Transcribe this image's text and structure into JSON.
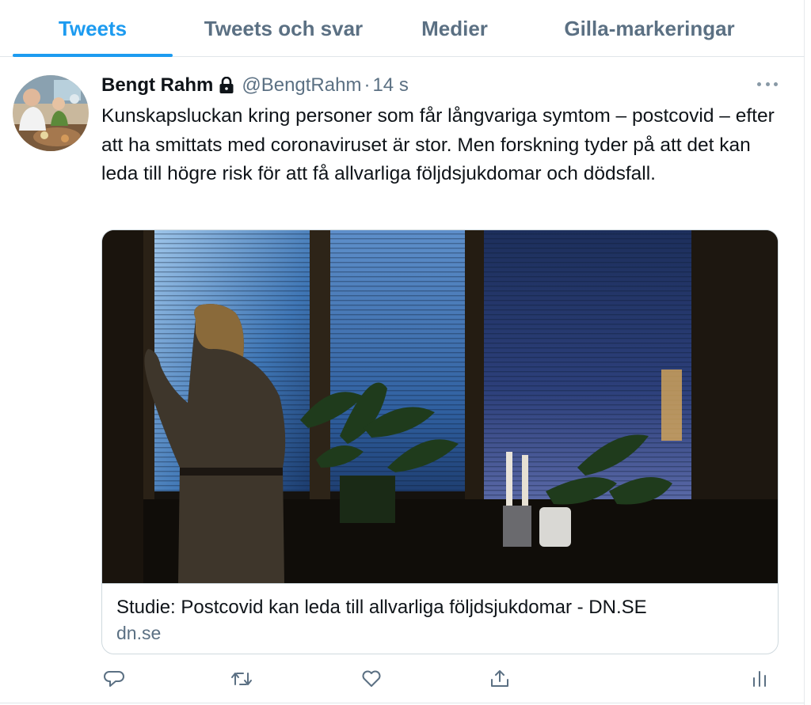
{
  "tabs": [
    {
      "label": "Tweets",
      "active": true
    },
    {
      "label": "Tweets och svar",
      "active": false
    },
    {
      "label": "Medier",
      "active": false
    },
    {
      "label": "Gilla-markeringar",
      "active": false
    }
  ],
  "tweet": {
    "author_name": "Bengt Rahm",
    "protected_icon": "lock-icon",
    "handle": "@BengtRahm",
    "separator": "·",
    "time": "14 s",
    "more_icon": "more-horizontal-icon",
    "text": "Kunskapsluckan kring personer som får långvariga symtom – postcovid – efter att ha smittats med coronaviruset är stor. Men forskning tyder på att det kan leda till högre risk för att få allvarliga följdsjukdomar och dödsfall.",
    "card": {
      "title": "Studie: Postcovid kan leda till allvarliga följdsjukdomar - DN.SE",
      "domain": "dn.se"
    },
    "actions": [
      {
        "name": "reply-icon"
      },
      {
        "name": "retweet-icon"
      },
      {
        "name": "like-icon"
      },
      {
        "name": "share-icon"
      },
      {
        "name": "analytics-icon"
      }
    ]
  },
  "colors": {
    "accent": "#1d9bf0",
    "secondary_text": "#5b7083",
    "primary_text": "#0f1419",
    "border": "#cfd9de"
  }
}
